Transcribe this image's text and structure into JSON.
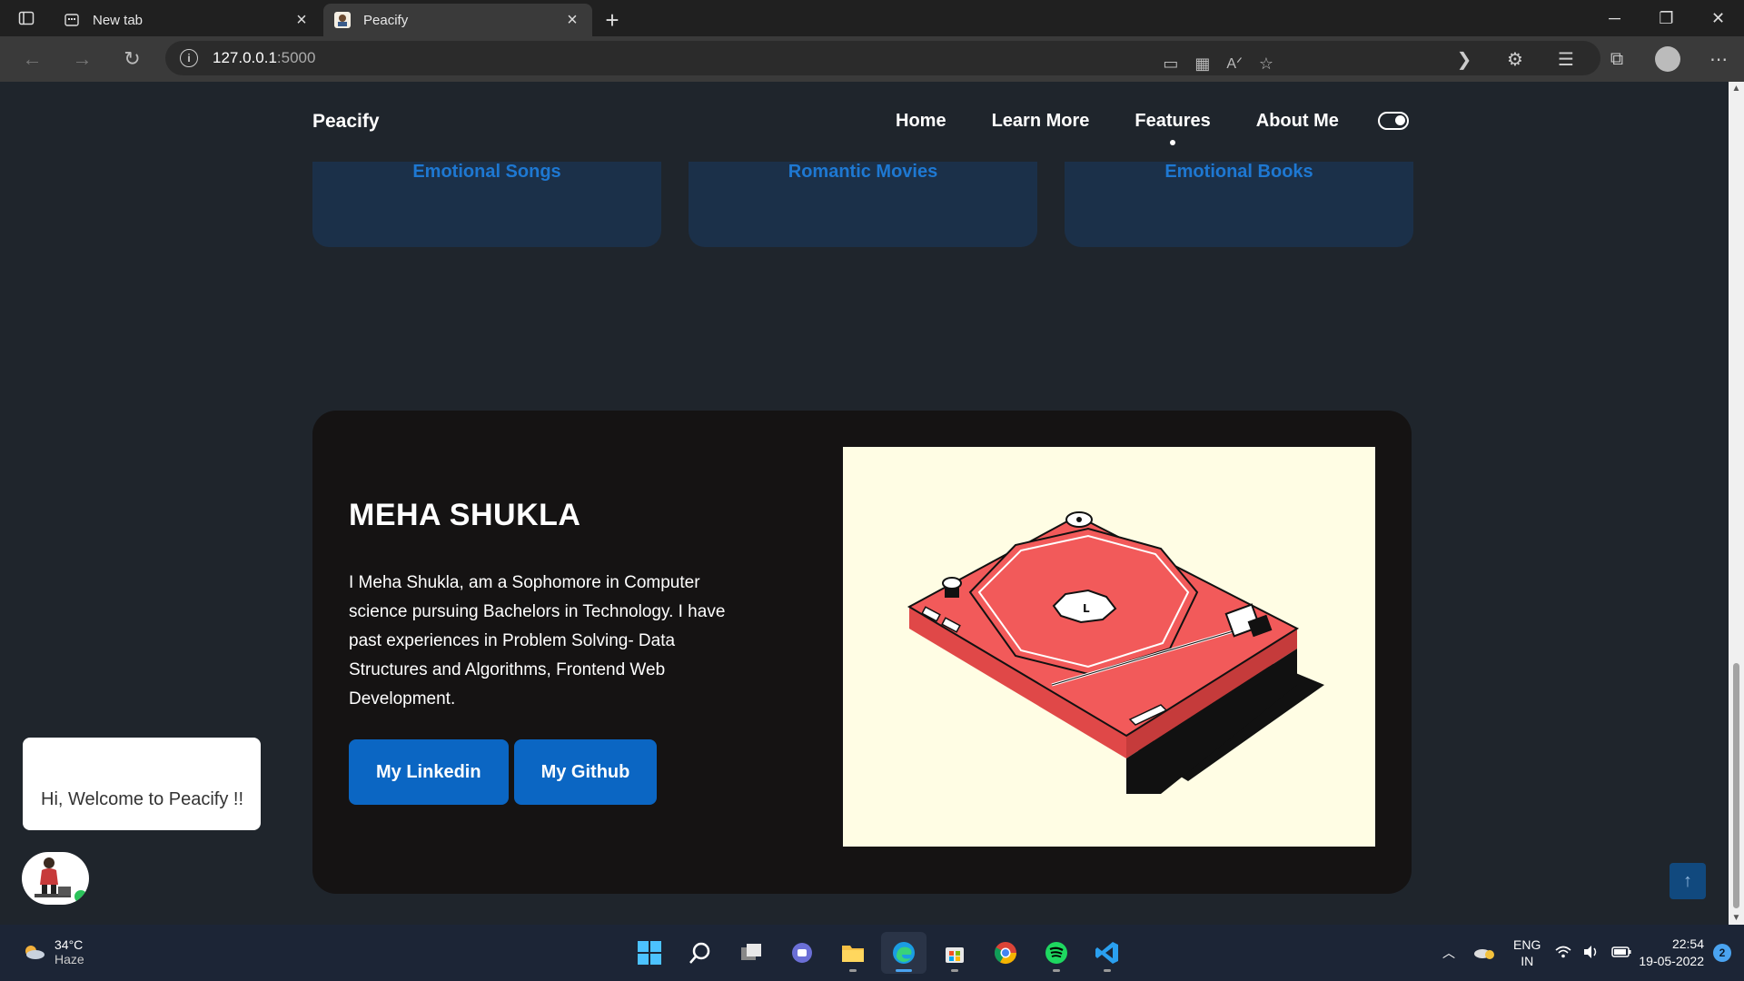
{
  "browser": {
    "tabs": [
      {
        "label": "New tab"
      },
      {
        "label": "Peacify"
      }
    ],
    "url_host": "127.0.0.1",
    "url_port": ":5000"
  },
  "site": {
    "brand": "Peacify",
    "nav": [
      {
        "label": "Home"
      },
      {
        "label": "Learn More"
      },
      {
        "label": "Features"
      },
      {
        "label": "About Me"
      }
    ],
    "active_nav": "Features",
    "cards": [
      {
        "label": "Emotional Songs"
      },
      {
        "label": "Romantic Movies"
      },
      {
        "label": "Emotional Books"
      }
    ],
    "about": {
      "name": "MEHA SHUKLA",
      "bio": "I Meha Shukla, am a Sophomore in Computer science pursuing Bachelors in Technology. I have past experiences in Problem Solving- Data Structures and Algorithms, Frontend Web Development.",
      "linkedin_label": "My Linkedin",
      "github_label": "My Github"
    },
    "chat_greeting": "Hi, Welcome to Peacify !!"
  },
  "taskbar": {
    "temperature": "34°C",
    "weather": "Haze",
    "language": "ENG",
    "region": "IN",
    "time": "22:54",
    "date": "19-05-2022",
    "notifications": "2"
  },
  "colors": {
    "page_bg": "#1f252c",
    "card_bg": "#1b3049",
    "card_text": "#1e78d2",
    "button_bg": "#0b66c3",
    "about_bg": "#151313",
    "illustration_bg": "#fffde4",
    "turntable": "#f25a5a"
  }
}
